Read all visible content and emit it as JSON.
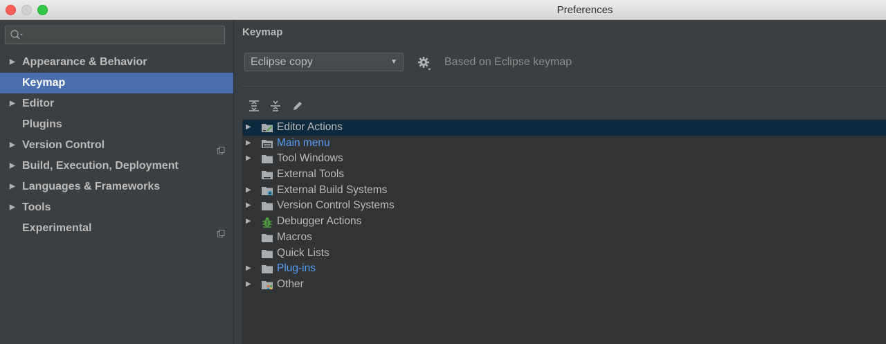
{
  "window": {
    "title": "Preferences"
  },
  "search": {
    "placeholder": ""
  },
  "sidebar": {
    "items": [
      {
        "label": "Appearance & Behavior",
        "expandable": true
      },
      {
        "label": "Keymap",
        "selected": true
      },
      {
        "label": "Editor",
        "expandable": true
      },
      {
        "label": "Plugins"
      },
      {
        "label": "Version Control",
        "expandable": true,
        "badge": "project-scope-icon"
      },
      {
        "label": "Build, Execution, Deployment",
        "expandable": true
      },
      {
        "label": "Languages & Frameworks",
        "expandable": true
      },
      {
        "label": "Tools",
        "expandable": true
      },
      {
        "label": "Experimental",
        "badge": "project-scope-icon"
      }
    ]
  },
  "main": {
    "heading": "Keymap",
    "keymap_select": "Eclipse copy",
    "based_on": "Based on Eclipse keymap",
    "toolbar": [
      "expand-all-icon",
      "collapse-all-icon",
      "edit-icon"
    ],
    "tree": [
      {
        "label": "Editor Actions",
        "expandable": true,
        "icon": "editor-actions-folder-icon",
        "selected": true
      },
      {
        "label": "Main menu",
        "expandable": true,
        "icon": "main-menu-folder-icon",
        "highlight": true
      },
      {
        "label": "Tool Windows",
        "expandable": true,
        "icon": "folder-icon"
      },
      {
        "label": "External Tools",
        "icon": "external-tools-folder-icon"
      },
      {
        "label": "External Build Systems",
        "expandable": true,
        "icon": "build-systems-folder-icon"
      },
      {
        "label": "Version Control Systems",
        "expandable": true,
        "icon": "folder-icon"
      },
      {
        "label": "Debugger Actions",
        "expandable": true,
        "icon": "debugger-bug-icon"
      },
      {
        "label": "Macros",
        "icon": "folder-icon"
      },
      {
        "label": "Quick Lists",
        "icon": "folder-icon"
      },
      {
        "label": "Plug-ins",
        "expandable": true,
        "icon": "folder-icon",
        "highlight": true
      },
      {
        "label": "Other",
        "expandable": true,
        "icon": "other-folder-icon"
      }
    ]
  },
  "colors": {
    "selection": "#4b6eaf",
    "link": "#589df6",
    "background": "#3c3f41",
    "tree_selection": "#0d293e"
  }
}
